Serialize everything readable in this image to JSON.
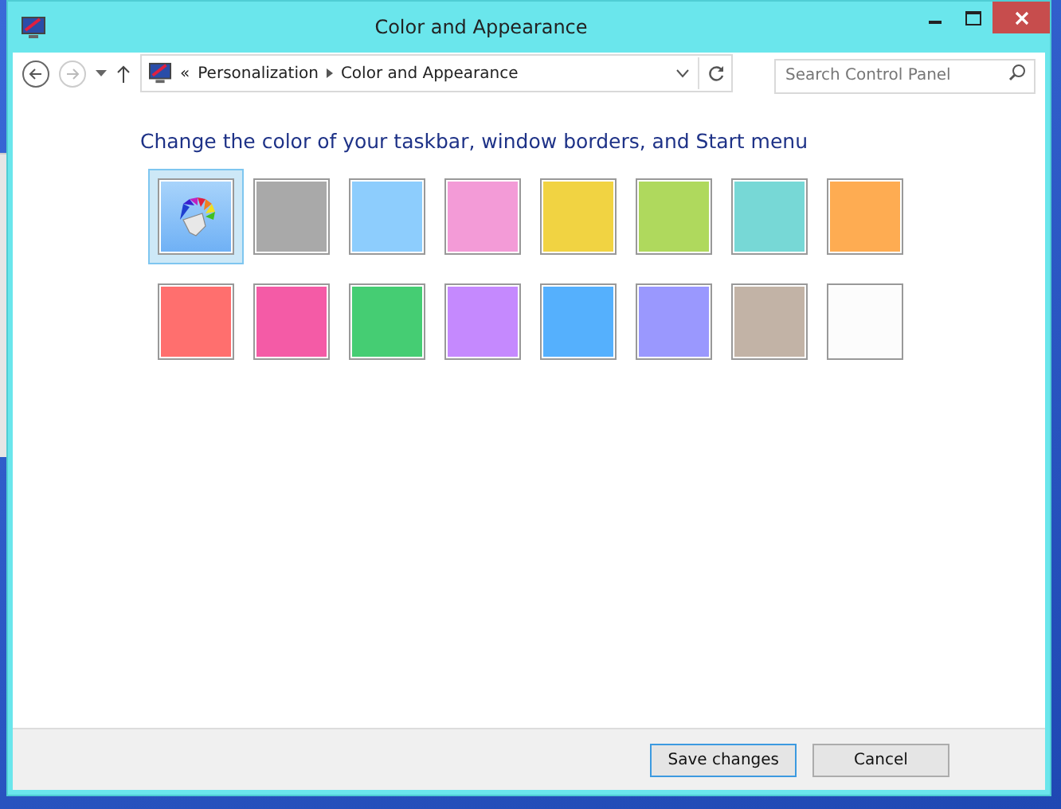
{
  "window": {
    "title": "Color and Appearance"
  },
  "address_bar": {
    "breadcrumbs": [
      "Personalization",
      "Color and Appearance"
    ],
    "separator": "«"
  },
  "search": {
    "placeholder": "Search Control Panel"
  },
  "heading": "Change the color of your taskbar, window borders, and Start menu",
  "swatches": [
    {
      "kind": "picker",
      "selected": true
    },
    {
      "kind": "color",
      "color": "#a9a9a9",
      "selected": false
    },
    {
      "kind": "color",
      "color": "#8dcdfd",
      "selected": false
    },
    {
      "kind": "color",
      "color": "#f39bd7",
      "selected": false
    },
    {
      "kind": "color",
      "color": "#f1d342",
      "selected": false
    },
    {
      "kind": "color",
      "color": "#afd95d",
      "selected": false
    },
    {
      "kind": "color",
      "color": "#77d8d6",
      "selected": false
    },
    {
      "kind": "color",
      "color": "#feac52",
      "selected": false
    },
    {
      "kind": "color",
      "color": "#ff6f6e",
      "selected": false
    },
    {
      "kind": "color",
      "color": "#f45ba6",
      "selected": false
    },
    {
      "kind": "color",
      "color": "#45cd73",
      "selected": false
    },
    {
      "kind": "color",
      "color": "#c589fe",
      "selected": false
    },
    {
      "kind": "color",
      "color": "#55b0fd",
      "selected": false
    },
    {
      "kind": "color",
      "color": "#9a98fe",
      "selected": false
    },
    {
      "kind": "color",
      "color": "#c2b3a6",
      "selected": false
    },
    {
      "kind": "color",
      "color": "#fcfcfc",
      "selected": false
    }
  ],
  "buttons": [
    {
      "label": "Save changes",
      "selected": true
    },
    {
      "label": "Cancel",
      "selected": false
    }
  ]
}
